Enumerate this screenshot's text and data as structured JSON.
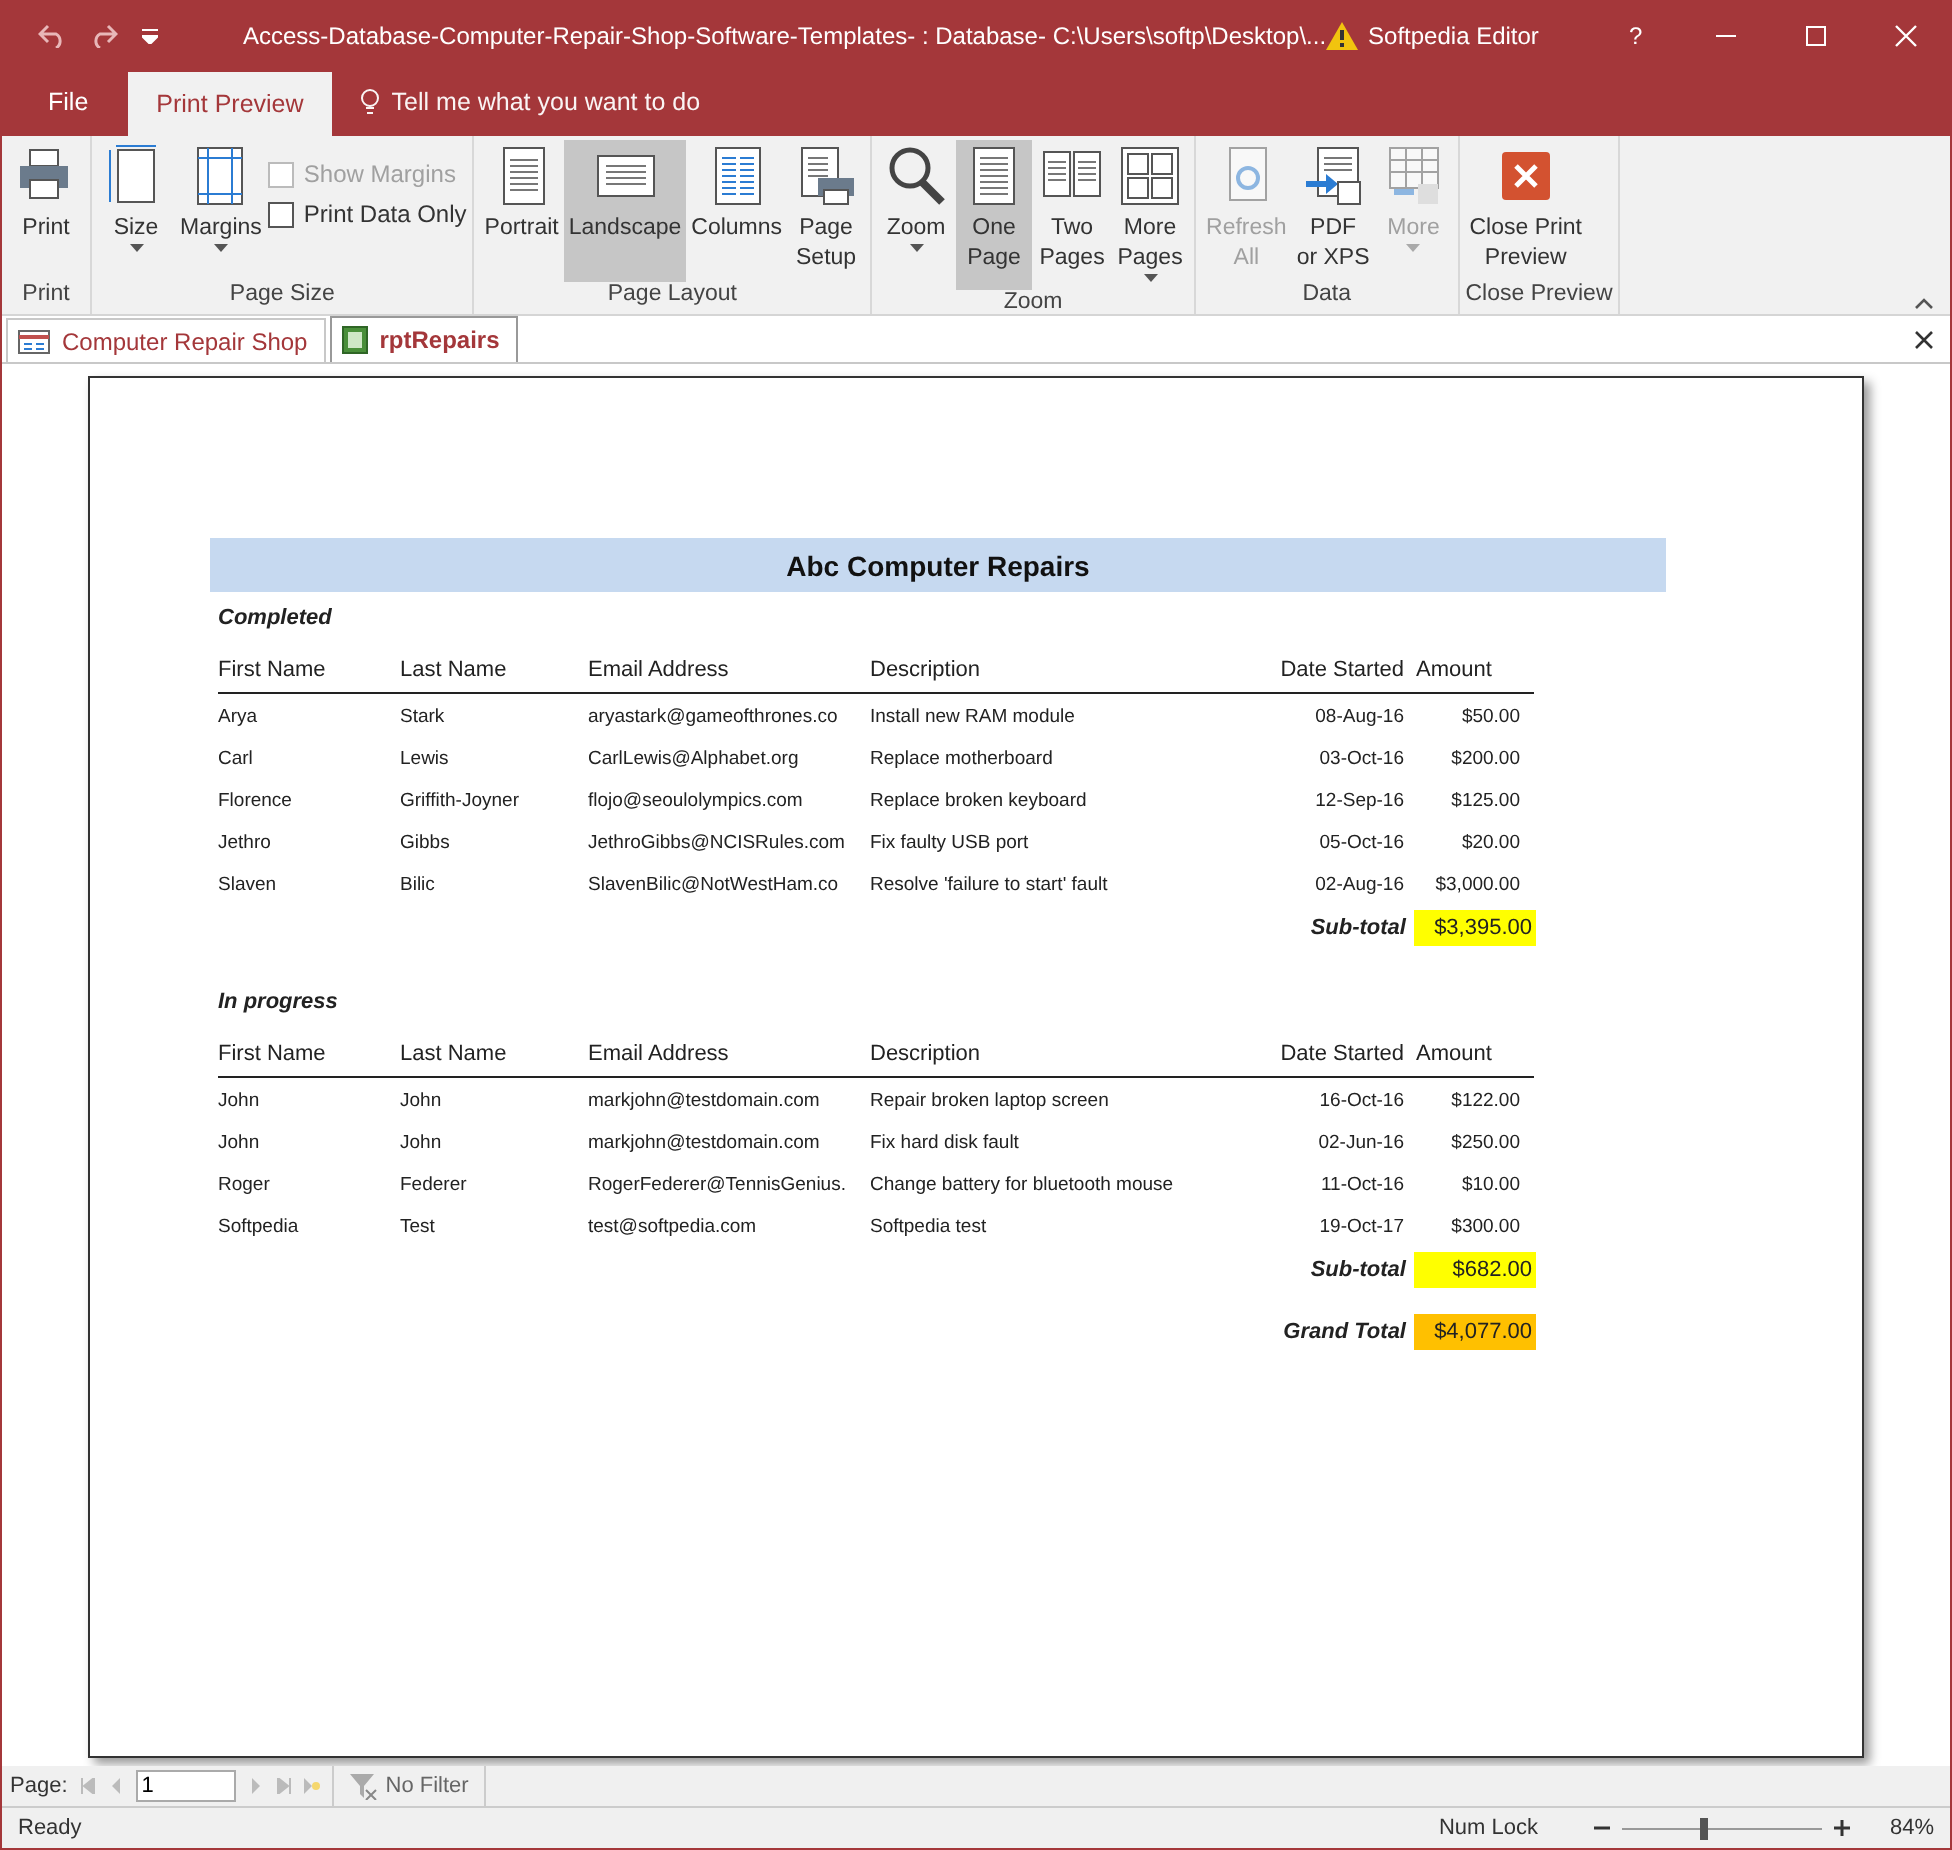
{
  "window": {
    "title": "Access-Database-Computer-Repair-Shop-Software-Templates- : Database- C:\\Users\\softp\\Desktop\\...",
    "account": "Softpedia Editor",
    "help": "?"
  },
  "ribbon_tabs": [
    {
      "label": "File",
      "selected": false
    },
    {
      "label": "Print Preview",
      "selected": true
    }
  ],
  "tell_me": {
    "placeholder": "Tell me what you want to do"
  },
  "ribbon_groups": [
    {
      "label": "Print",
      "buttons": [
        {
          "kind": "large",
          "lines": [
            "Print"
          ],
          "selected": false,
          "disabled": false,
          "dropdown": false
        }
      ]
    },
    {
      "label": "Page Size",
      "buttons": [
        {
          "kind": "large",
          "lines": [
            "Size"
          ],
          "selected": false,
          "disabled": false,
          "dropdown": true
        },
        {
          "kind": "large",
          "lines": [
            "Margins"
          ],
          "selected": false,
          "disabled": false,
          "dropdown": true
        },
        {
          "kind": "checks",
          "items": [
            {
              "label": "Show Margins",
              "checked": false,
              "disabled": true
            },
            {
              "label": "Print Data Only",
              "checked": false,
              "disabled": false
            }
          ]
        }
      ]
    },
    {
      "label": "Page Layout",
      "buttons": [
        {
          "kind": "large",
          "lines": [
            "Portrait"
          ],
          "selected": false,
          "disabled": false,
          "dropdown": false
        },
        {
          "kind": "large",
          "lines": [
            "Landscape"
          ],
          "selected": true,
          "disabled": false,
          "dropdown": false
        },
        {
          "kind": "large",
          "lines": [
            "Columns"
          ],
          "selected": false,
          "disabled": false,
          "dropdown": false
        },
        {
          "kind": "large",
          "lines": [
            "Page",
            "Setup"
          ],
          "selected": false,
          "disabled": false,
          "dropdown": false
        }
      ]
    },
    {
      "label": "Zoom",
      "buttons": [
        {
          "kind": "large",
          "lines": [
            "Zoom"
          ],
          "selected": false,
          "disabled": false,
          "dropdown": true
        },
        {
          "kind": "large",
          "lines": [
            "One",
            "Page"
          ],
          "selected": true,
          "disabled": false,
          "dropdown": false
        },
        {
          "kind": "large",
          "lines": [
            "Two",
            "Pages"
          ],
          "selected": false,
          "disabled": false,
          "dropdown": false
        },
        {
          "kind": "large",
          "lines": [
            "More",
            "Pages"
          ],
          "selected": false,
          "disabled": false,
          "dropdown": true
        }
      ]
    },
    {
      "label": "Data",
      "buttons": [
        {
          "kind": "large",
          "lines": [
            "Refresh",
            "All"
          ],
          "selected": false,
          "disabled": true,
          "dropdown": false
        },
        {
          "kind": "large",
          "lines": [
            "PDF",
            "or XPS"
          ],
          "selected": false,
          "disabled": false,
          "dropdown": false
        },
        {
          "kind": "large",
          "lines": [
            "More"
          ],
          "selected": false,
          "disabled": true,
          "dropdown": true
        }
      ]
    },
    {
      "label": "Close Preview",
      "buttons": [
        {
          "kind": "large",
          "lines": [
            "Close Print",
            "Preview"
          ],
          "selected": false,
          "disabled": false,
          "dropdown": false
        }
      ]
    }
  ],
  "doc_tabs": [
    {
      "label": "Computer Repair Shop",
      "selected": false
    },
    {
      "label": "rptRepairs",
      "selected": true
    }
  ],
  "report": {
    "title": "Abc Computer Repairs",
    "sections": [
      {
        "heading": "Completed",
        "columns": [
          "First Name",
          "Last Name",
          "Email Address",
          "Description",
          "Date Started",
          "Amount"
        ],
        "rows": [
          [
            "Arya",
            "Stark",
            "aryastark@gameofthrones.co",
            "Install new RAM module",
            "08-Aug-16",
            "$50.00"
          ],
          [
            "Carl",
            "Lewis",
            "CarlLewis@Alphabet.org",
            "Replace motherboard",
            "03-Oct-16",
            "$200.00"
          ],
          [
            "Florence",
            "Griffith-Joyner",
            "flojo@seoulolympics.com",
            "Replace broken keyboard",
            "12-Sep-16",
            "$125.00"
          ],
          [
            "Jethro",
            "Gibbs",
            "JethroGibbs@NCISRules.com",
            "Fix faulty USB port",
            "05-Oct-16",
            "$20.00"
          ],
          [
            "Slaven",
            "Bilic",
            "SlavenBilic@NotWestHam.co",
            "Resolve 'failure to start' fault",
            "02-Aug-16",
            "$3,000.00"
          ]
        ],
        "total": {
          "label": "Sub-total",
          "amount": "$3,395.00",
          "color": "#ffff00"
        }
      },
      {
        "heading": "In progress",
        "columns": [
          "First Name",
          "Last Name",
          "Email Address",
          "Description",
          "Date Started",
          "Amount"
        ],
        "rows": [
          [
            "John",
            "John",
            "markjohn@testdomain.com",
            "Repair broken laptop screen",
            "16-Oct-16",
            "$122.00"
          ],
          [
            "John",
            "John",
            "markjohn@testdomain.com",
            "Fix hard disk fault",
            "02-Jun-16",
            "$250.00"
          ],
          [
            "Roger",
            "Federer",
            "RogerFederer@TennisGenius.",
            "Change battery for bluetooth mouse",
            "11-Oct-16",
            "$10.00"
          ],
          [
            "Softpedia",
            "Test",
            "test@softpedia.com",
            "Softpedia test",
            "19-Oct-17",
            "$300.00"
          ]
        ],
        "total": {
          "label": "Sub-total",
          "amount": "$682.00",
          "color": "#ffff00"
        }
      }
    ],
    "grand_total": {
      "label": "Grand Total",
      "amount": "$4,077.00",
      "color": "#ffc000"
    }
  },
  "navigation": {
    "label": "Page:",
    "value": "1",
    "filter": "No Filter"
  },
  "status_bar": {
    "text": "Ready",
    "num_lock": "Num Lock",
    "zoom": {
      "level": 0.41
    },
    "zoom_reading": "84%"
  }
}
